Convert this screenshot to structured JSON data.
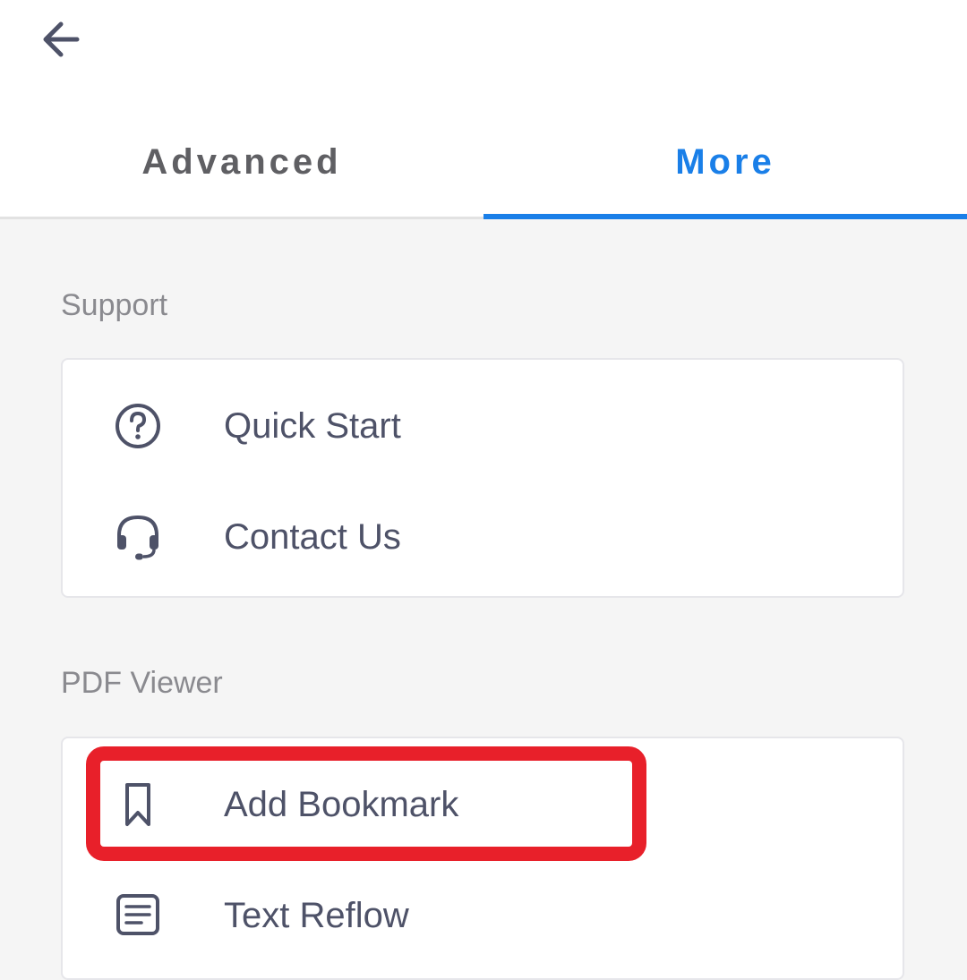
{
  "header": {
    "back_icon": "arrow-left-icon",
    "tabs": [
      {
        "label": "Advanced",
        "active": false
      },
      {
        "label": "More",
        "active": true
      }
    ]
  },
  "sections": [
    {
      "title": "Support",
      "items": [
        {
          "label": "Quick Start",
          "icon": "question-circle-icon"
        },
        {
          "label": "Contact Us",
          "icon": "headset-icon"
        }
      ]
    },
    {
      "title": "PDF Viewer",
      "items": [
        {
          "label": "Add Bookmark",
          "icon": "bookmark-icon",
          "highlighted": true
        },
        {
          "label": "Text Reflow",
          "icon": "text-reflow-icon"
        }
      ]
    }
  ],
  "colors": {
    "accent": "#1a7fe8",
    "highlight": "#e8202a",
    "icon": "#4e5268",
    "background": "#f5f5f5"
  }
}
